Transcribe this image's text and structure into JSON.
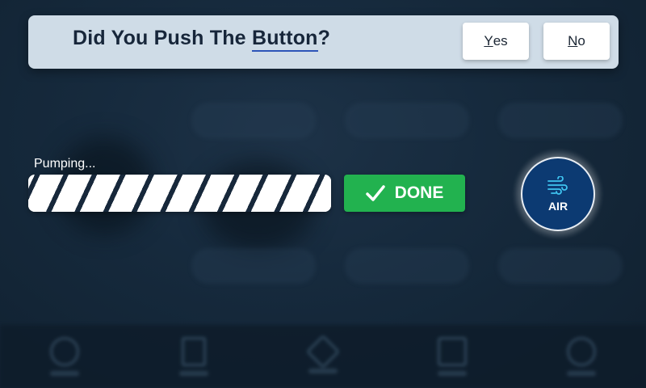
{
  "dialog": {
    "title_prefix": "Did You Push The ",
    "title_emphasis": "Button",
    "title_suffix": "?",
    "yes_button": {
      "mnemonic": "Y",
      "rest": "es"
    },
    "no_button": {
      "mnemonic": "N",
      "rest": "o"
    }
  },
  "progress": {
    "label": "Pumping...",
    "value_fraction": 1.0
  },
  "done_button": {
    "label": "DONE",
    "icon": "checkmark-icon",
    "color": "#22b24f"
  },
  "air_button": {
    "label": "AIR",
    "icon": "wind-icon",
    "color": "#0c3a72",
    "icon_color": "#3fc4f0"
  },
  "colors": {
    "dialog_background": "#cfdce7",
    "title_text": "#17263a",
    "emphasis_underline": "#2d55b8",
    "page_background": "#162a3d"
  }
}
